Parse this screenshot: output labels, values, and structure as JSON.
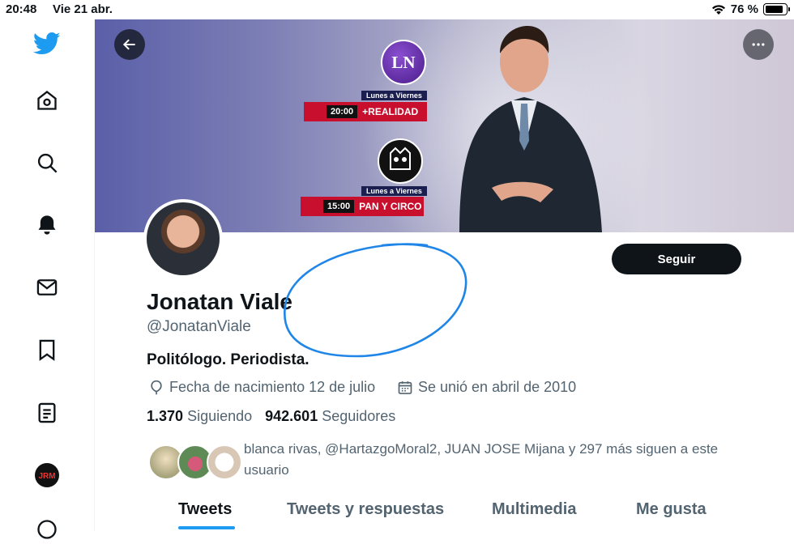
{
  "status": {
    "time": "20:48",
    "date": "Vie 21 abr.",
    "battery": "76 %",
    "battery_level": 0.76
  },
  "sidebar": {
    "items": [
      {
        "icon": "twitter-bird-icon"
      },
      {
        "icon": "home-icon"
      },
      {
        "icon": "search-icon"
      },
      {
        "icon": "notifications-bell-icon"
      },
      {
        "icon": "messages-envelope-icon"
      },
      {
        "icon": "bookmark-icon"
      },
      {
        "icon": "lists-icon"
      },
      {
        "icon": "account-avatar-icon",
        "label": "JRM"
      }
    ]
  },
  "banner": {
    "ln_logo": "LN",
    "show1": {
      "days": "Lunes a Viernes",
      "time": "20:00",
      "title": "+REALIDAD"
    },
    "show2": {
      "days": "Lunes a Viernes",
      "time": "15:00",
      "title": "PAN Y CIRCO"
    }
  },
  "profile": {
    "name": "Jonatan Viale",
    "handle": "@JonatanViale",
    "bio": "Politólogo. Periodista.",
    "birthday": "Fecha de nacimiento 12 de julio",
    "joined": "Se unió en abril de 2010",
    "following_count": "1.370",
    "following_label": "Siguiendo",
    "followers_count": "942.601",
    "followers_label": "Seguidores",
    "known_followers": "blanca rivas, @HartazgoMoral2, JUAN JOSE Mijana y 297 más siguen a este usuario"
  },
  "actions": {
    "follow": "Seguir"
  },
  "tabs": [
    {
      "label": "Tweets",
      "active": true
    },
    {
      "label": "Tweets y respuestas"
    },
    {
      "label": "Multimedia"
    },
    {
      "label": "Me gusta"
    }
  ],
  "colors": {
    "accent": "#1d9bf0",
    "text": "#0f1419",
    "muted": "#536471",
    "annotation": "#1f86e8"
  }
}
